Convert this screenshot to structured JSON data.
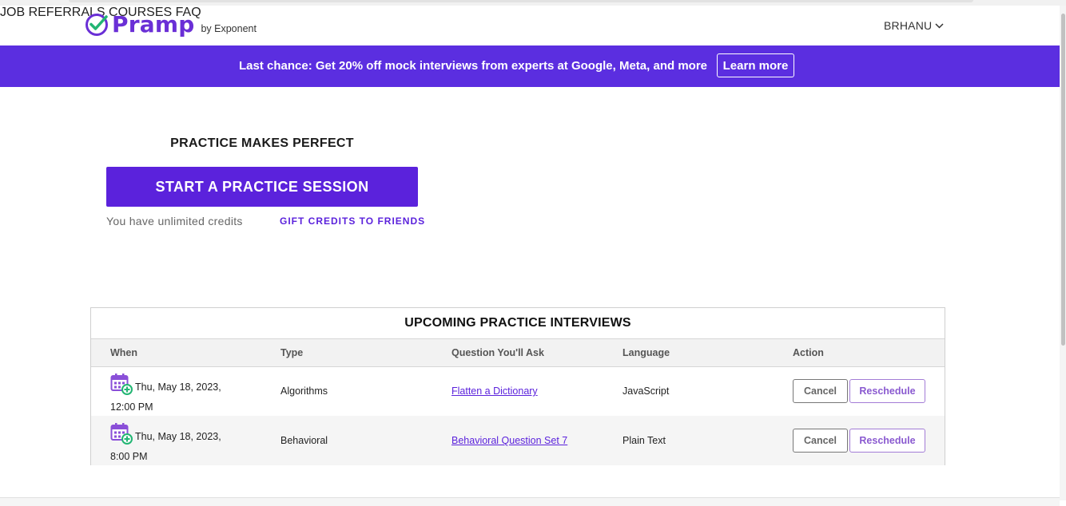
{
  "header": {
    "logo_text": "Pramp",
    "logo_sub": "by Exponent",
    "nav": [
      "JOB REFERRALS",
      "COURSES",
      "FAQ"
    ],
    "user": "BRHANU"
  },
  "banner": {
    "text": "Last chance: Get 20% off mock interviews from experts at Google, Meta, and more",
    "button": "Learn more",
    "color": "#5b2ee0"
  },
  "practice": {
    "title": "PRACTICE MAKES PERFECT",
    "start_button": "START A PRACTICE SESSION",
    "credits": "You have unlimited credits",
    "gift_link": "GIFT CREDITS TO FRIENDS"
  },
  "upcoming": {
    "title": "UPCOMING PRACTICE INTERVIEWS",
    "columns": [
      "When",
      "Type",
      "Question You'll Ask",
      "Language",
      "Action"
    ],
    "rows": [
      {
        "date": "Thu, May 18, 2023,",
        "time": "12:00 PM",
        "type": "Algorithms",
        "question": "Flatten a Dictionary",
        "language": "JavaScript",
        "cancel": "Cancel",
        "reschedule": "Reschedule"
      },
      {
        "date": "Thu, May 18, 2023,",
        "time": "8:00 PM",
        "type": "Behavioral",
        "question": "Behavioral Question Set 7",
        "language": "Plain Text",
        "cancel": "Cancel",
        "reschedule": "Reschedule"
      }
    ]
  },
  "colors": {
    "brand": "#5b22dc",
    "accent_green": "#22b573"
  }
}
